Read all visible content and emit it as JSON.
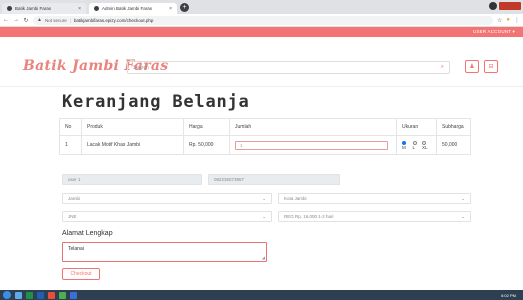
{
  "browser": {
    "tabs": [
      {
        "label": "Batik Jambi Faras"
      },
      {
        "label": "Admin Batik Jambi Faras"
      }
    ],
    "not_secure": "Not secure",
    "url": "batikjambifaras.epizy.com/checkout.php"
  },
  "usernav": {
    "account": "USER ACCOUNT ▾"
  },
  "header": {
    "brand": "Batik Jambi Faras",
    "search_placeholder": "Search"
  },
  "page": {
    "title": "Keranjang Belanja",
    "table": {
      "headers": [
        "No",
        "Produk",
        "Harga",
        "Jumlah",
        "Ukuran",
        "Subharga"
      ],
      "rows": [
        {
          "no": "1",
          "produk": "Lacak Motif Khas Jambi",
          "harga": "Rp. 50,000",
          "jumlah": "1",
          "sizes": [
            "M",
            "L",
            "XL"
          ],
          "selected_size": "M",
          "subharga": "50,000"
        }
      ]
    },
    "form": {
      "name": "user 1",
      "phone": "082236073957",
      "province": "Jambi",
      "city_placeholder": "Kota Jambi",
      "courier": "JNE",
      "service": "REG Rp. 16,000 1-2 hari",
      "address_label": "Alamat Lengkap",
      "address_value": "Telanai",
      "checkout_label": "Checkout"
    }
  },
  "taskbar": {
    "clock": "6:02 PM"
  },
  "colors": {
    "accent": "#f27474",
    "brand": "#e9837c"
  }
}
